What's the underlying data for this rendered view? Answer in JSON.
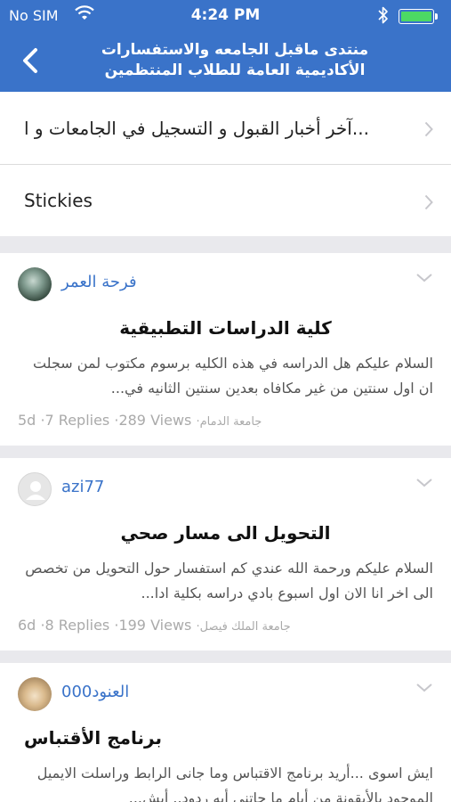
{
  "status_bar": {
    "carrier": "No SIM",
    "time": "4:24 PM"
  },
  "header": {
    "title_line1": "منتدى ماقبل الجامعه والاستفسارات",
    "title_line2": "الأكاديمية العامة للطلاب المنتظمين"
  },
  "nav": {
    "items": [
      {
        "label": "آخر أخبار القبول و التسجيل في الجامعات و ا..."
      },
      {
        "label": "Stickies"
      }
    ]
  },
  "topics": [
    {
      "author": "فرحة العمر",
      "title": "كلية الدراسات التطبيقية",
      "preview": "السلام عليكم هل الدراسه في هذه الكليه برسوم مكتوب لمن سجلت ان اول سنتين من غير مكافاه بعدين سنتين الثانيه في...",
      "age": "5d",
      "replies": "·7 Replies",
      "views": "·289 Views",
      "forum": "·جامعة الدمام"
    },
    {
      "author": "azi77",
      "title": "التحويل الى مسار صحي",
      "preview": "السلام عليكم ورحمة الله عندي كم استفسار حول التحويل من تخصص الى اخر انا الان اول اسبوع بادي دراسه بكلية ادا...",
      "age": "6d",
      "replies": "·8 Replies",
      "views": "·199 Views",
      "forum": "·جامعة الملك فيصل"
    },
    {
      "author": "العنود000",
      "title": "برنامج الأقتباس",
      "preview": "ايش اسوى ...أريد برنامج الاقتباس وما جانى الرابط وراسلت الايميل الموجود بالأيقونة من أيام ما جاتني أيه ردود.. أيش...",
      "age": "",
      "replies": "",
      "views": "",
      "forum": ""
    }
  ],
  "colors": {
    "header_bg": "#3a73c9",
    "author_link": "#3a73c9",
    "battery": "#4cd964"
  }
}
